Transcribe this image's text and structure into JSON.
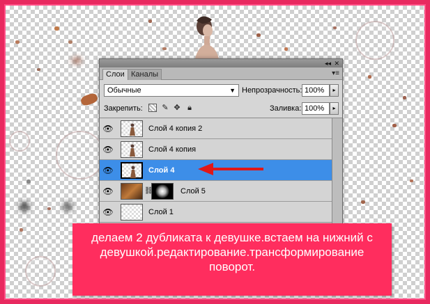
{
  "panel": {
    "tabs": [
      "Слои",
      "Каналы"
    ],
    "window_controls": "◂◂ ✕",
    "menu_icon": "≡",
    "blend_mode": "Обычные",
    "opacity_label": "Непрозрачность:",
    "opacity_value": "100%",
    "lock_label": "Закрепить:",
    "fill_label": "Заливка:",
    "fill_value": "100%",
    "layers": [
      {
        "name": "Слой 4 копия 2",
        "visible": true,
        "selected": false,
        "thumb": "figure"
      },
      {
        "name": "Слой 4 копия",
        "visible": true,
        "selected": false,
        "thumb": "figure"
      },
      {
        "name": "Слой 4",
        "visible": true,
        "selected": true,
        "thumb": "figure"
      },
      {
        "name": "Слой 5",
        "visible": true,
        "selected": false,
        "thumb": "texture-with-mask"
      },
      {
        "name": "Слой 1",
        "visible": true,
        "selected": false,
        "thumb": "empty"
      }
    ]
  },
  "caption": "делаем 2 дубликата к девушке.встаем на нижний с девушкой.редактирование.трансформирование поворот.",
  "colors": {
    "border": "#e8295f",
    "caption_bg": "#ff2d5e",
    "selected_layer": "#3d8ee8",
    "arrow": "#e01818"
  },
  "icons": {
    "eye": "eye-icon",
    "lock_transparent": "checker-lock-icon",
    "lock_brush": "brush-icon",
    "lock_move": "move-icon",
    "lock_all": "lock-icon",
    "chain": "chain-link-icon"
  }
}
